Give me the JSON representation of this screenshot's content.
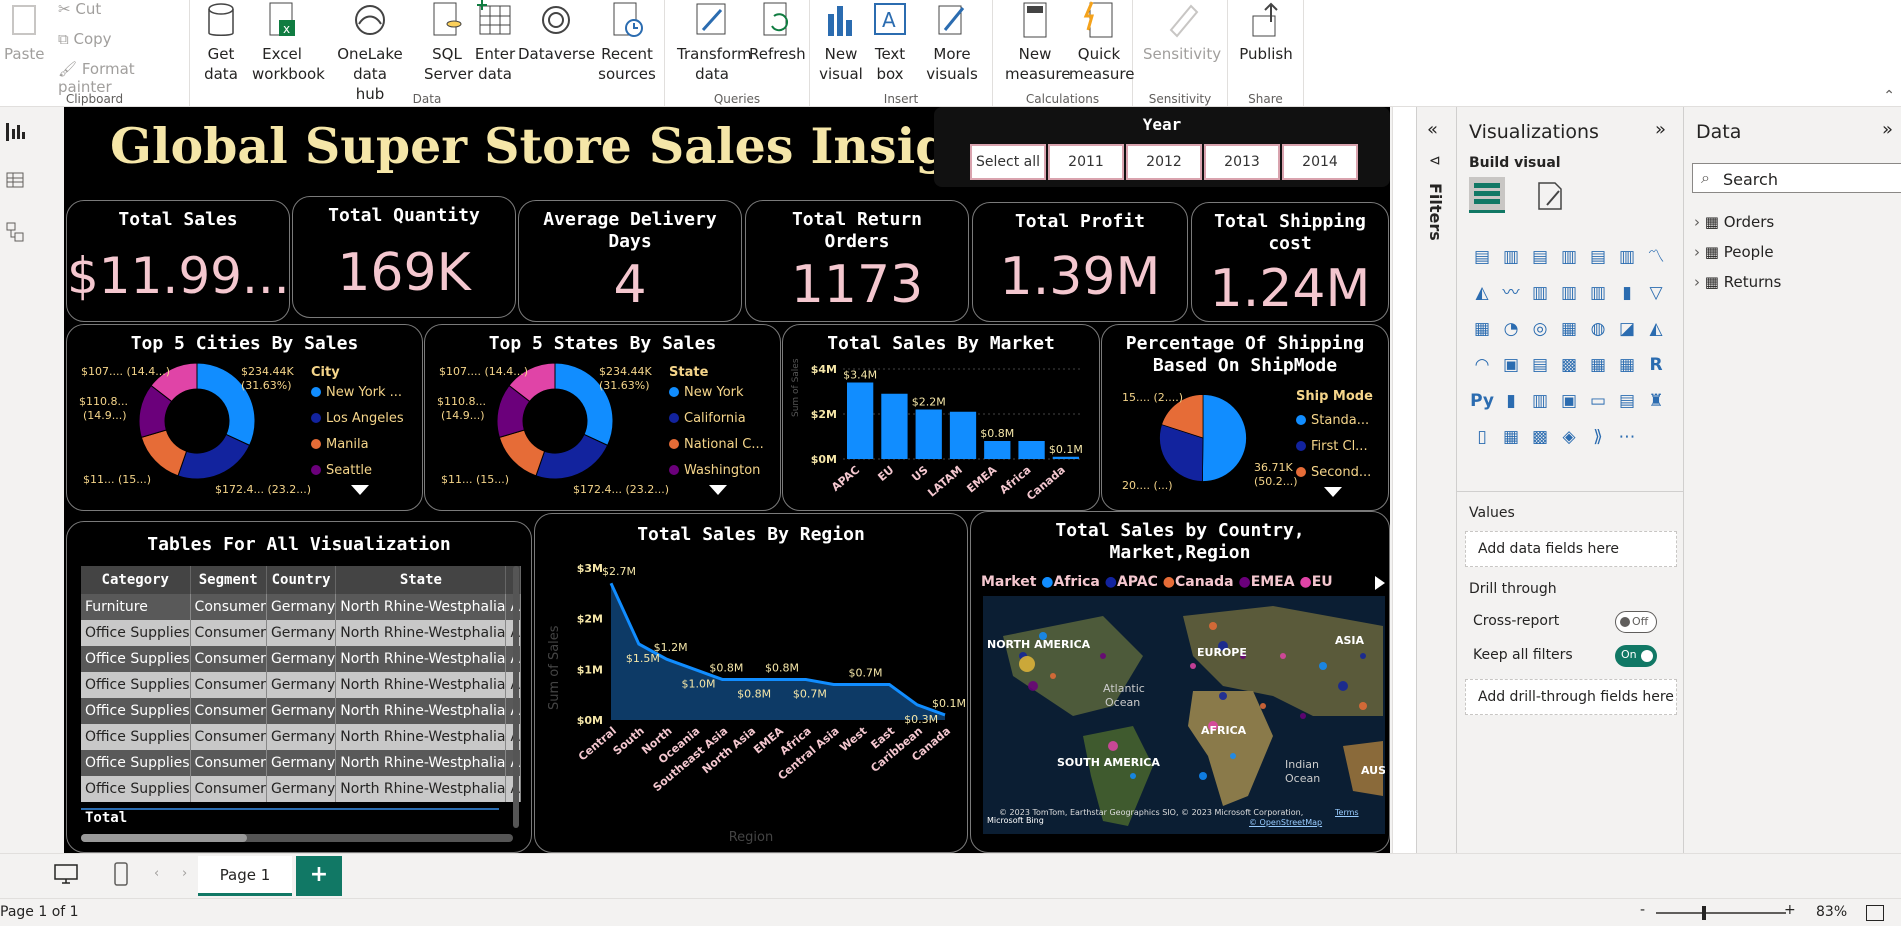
{
  "ribbon": {
    "clipboard": {
      "paste": "Paste",
      "cut": "Cut",
      "copy": "Copy",
      "format_painter": "Format painter",
      "group": "Clipboard"
    },
    "data": {
      "group": "Data",
      "get_data": [
        "Get",
        "data"
      ],
      "excel": [
        "Excel",
        "workbook"
      ],
      "onelake": [
        "OneLake data",
        "hub"
      ],
      "sql": [
        "SQL",
        "Server"
      ],
      "enter": [
        "Enter",
        "data"
      ],
      "dataverse": [
        "Dataverse",
        ""
      ],
      "recent": [
        "Recent",
        "sources"
      ]
    },
    "queries": {
      "group": "Queries",
      "transform": [
        "Transform",
        "data"
      ],
      "refresh": [
        "Refresh",
        ""
      ]
    },
    "insert": {
      "group": "Insert",
      "new_visual": [
        "New",
        "visual"
      ],
      "text_box": [
        "Text",
        "box"
      ],
      "more_visuals": [
        "More",
        "visuals"
      ]
    },
    "calculations": {
      "group": "Calculations",
      "new_measure": [
        "New",
        "measure"
      ],
      "quick_measure": [
        "Quick",
        "measure"
      ]
    },
    "sensitivity": {
      "group": "Sensitivity",
      "label": "Sensitivity"
    },
    "share": {
      "group": "Share",
      "publish": "Publish"
    }
  },
  "report": {
    "title": "Global Super Store Sales Insights",
    "year_slicer": {
      "title": "Year",
      "options": [
        "Select all",
        "2011",
        "2012",
        "2013",
        "2014"
      ]
    },
    "kpis": [
      {
        "title": "Total Sales",
        "value": "$11.99..."
      },
      {
        "title": "Total Quantity",
        "value": "169K"
      },
      {
        "title": "Average Delivery Days",
        "value": "4"
      },
      {
        "title": "Total Return Orders",
        "value": "1173"
      },
      {
        "title": "Total Profit",
        "value": "1.39M"
      },
      {
        "title": "Total Shipping cost",
        "value": "1.24M"
      }
    ],
    "cities": {
      "title": "Top 5 Cities By Sales",
      "legend_title": "City",
      "legend": [
        "New York ...",
        "Los Angeles",
        "Manila",
        "Seattle"
      ],
      "labels": {
        "top_left": "$107.... (14.4...)",
        "mid_left": "$110.8...",
        "mid_left2": "(14.9...)",
        "bottom_left": "$11... (15...)",
        "top_right": "$234.44K",
        "top_right2": "(31.63%)",
        "bottom_right": "$172.4... (23.2...)"
      }
    },
    "states": {
      "title": "Top 5 States By Sales",
      "legend_title": "State",
      "legend": [
        "New York",
        "California",
        "National C...",
        "Washington"
      ],
      "labels": {
        "top_left": "$107.... (14.4...)",
        "mid_left": "$110.8...",
        "mid_left2": "(14.9...)",
        "bottom_left": "$11... (15...)",
        "top_right": "$234.44K",
        "top_right2": "(31.63%)",
        "bottom_right": "$172.4... (23.2...)"
      }
    },
    "market": {
      "title": "Total Sales By Market",
      "ylabel": "Sum of Sales"
    },
    "shipmode": {
      "title": "Percentage Of Shipping Based On ShipMode",
      "legend_title": "Ship Mode",
      "legend": [
        "Standa...",
        "First Cl...",
        "Second..."
      ],
      "labels": {
        "top_left": "15.... (2....)",
        "bottom_left": "20.... (...)",
        "right": "36.71K",
        "right2": "(50.2...)"
      }
    },
    "table": {
      "title": "Tables For All Visualization",
      "columns": [
        "Category",
        "Segment",
        "Country",
        "State"
      ],
      "rows": [
        [
          "Furniture",
          "Consumer",
          "Germany",
          "North Rhine-Westphalia"
        ],
        [
          "Office Supplies",
          "Consumer",
          "Germany",
          "North Rhine-Westphalia"
        ],
        [
          "Office Supplies",
          "Consumer",
          "Germany",
          "North Rhine-Westphalia"
        ],
        [
          "Office Supplies",
          "Consumer",
          "Germany",
          "North Rhine-Westphalia"
        ],
        [
          "Office Supplies",
          "Consumer",
          "Germany",
          "North Rhine-Westphalia"
        ],
        [
          "Office Supplies",
          "Consumer",
          "Germany",
          "North Rhine-Westphalia"
        ],
        [
          "Office Supplies",
          "Consumer",
          "Germany",
          "North Rhine-Westphalia"
        ],
        [
          "Office Supplies",
          "Consumer",
          "Germany",
          "North Rhine-Westphalia"
        ]
      ],
      "extra_col": "A",
      "total": "Total"
    },
    "region": {
      "title": "Total Sales By Region",
      "ylabel": "Sum of Sales",
      "xlabel": "Region"
    },
    "map": {
      "title": "Total Sales by Country, Market,Region",
      "legend_title": "Market",
      "legend": [
        "Africa",
        "APAC",
        "Canada",
        "EMEA",
        "EU"
      ],
      "labels": [
        "NORTH AMERICA",
        "EUROPE",
        "ASIA",
        "Atlantic",
        "Ocean",
        "AFRICA",
        "SOUTH AMERICA",
        "Indian",
        "Ocean",
        "AUS"
      ],
      "attribution": "© 2023 TomTom, Earthstar Geographics SIO, © 2023 Microsoft Corporation,",
      "terms": "Terms",
      "osm": "© OpenStreetMap",
      "bing": "Microsoft Bing"
    }
  },
  "filters_label": "Filters",
  "viz_pane": {
    "title": "Visualizations",
    "build": "Build visual",
    "values": "Values",
    "add_fields": "Add data fields here",
    "drill": "Drill through",
    "cross_report": "Cross-report",
    "cross_state": "Off",
    "keep_filters": "Keep all filters",
    "keep_state": "On",
    "add_drill": "Add drill-through fields here"
  },
  "data_pane": {
    "title": "Data",
    "search_placeholder": "Search",
    "tables": [
      "Orders",
      "People",
      "Returns"
    ]
  },
  "pages": {
    "tab": "Page 1",
    "add": "+"
  },
  "status": {
    "page": "Page 1 of 1",
    "zoom": "83%",
    "minus": "-",
    "plus": "+"
  },
  "colors": {
    "gold": "#f5e6a8",
    "pink_value": "#f4c7cf",
    "blue": "#118dff",
    "navy": "#12239e",
    "orange": "#e66c37",
    "purple": "#6b007b",
    "magenta": "#e044a7"
  },
  "chart_data": [
    {
      "type": "bar",
      "title": "Total Sales By Market",
      "categories": [
        "APAC",
        "EU",
        "US",
        "LATAM",
        "EMEA",
        "Africa",
        "Canada"
      ],
      "values": [
        3.4,
        2.9,
        2.2,
        2.1,
        0.8,
        0.8,
        0.1
      ],
      "data_labels": [
        "$3.4M",
        "",
        "$2.2M",
        "",
        "$0.8M",
        "",
        "$0.1M"
      ],
      "yticks": [
        "$4M",
        "$2M",
        "$0M"
      ],
      "ylim": [
        0,
        4
      ],
      "unit": "$M"
    },
    {
      "type": "area",
      "title": "Total Sales By Region",
      "categories": [
        "Central",
        "South",
        "North",
        "Oceania",
        "Southeast Asia",
        "North Asia",
        "EMEA",
        "Africa",
        "Central Asia",
        "West",
        "East",
        "Caribbean",
        "Canada"
      ],
      "values": [
        2.7,
        1.5,
        1.2,
        1.0,
        0.8,
        0.8,
        0.8,
        0.8,
        0.7,
        0.7,
        0.7,
        0.3,
        0.1
      ],
      "data_labels": [
        "$2.7M",
        "$1.5M",
        "$1.2M",
        "$1.0M",
        "$0.8M",
        "$0.8M",
        "$0.8M",
        "$0.7M",
        "$0.7M",
        "$0.3M",
        "$0.1M"
      ],
      "yticks": [
        "$3M",
        "$2M",
        "$1M",
        "$0M"
      ],
      "ylim": [
        0,
        3
      ],
      "unit": "$M"
    },
    {
      "type": "pie",
      "title": "Top 5 Cities By Sales",
      "categories": [
        "New York City",
        "Los Angeles",
        "Manila",
        "Seattle",
        "Other"
      ],
      "values": [
        31.63,
        23.2,
        15,
        14.9,
        14.4
      ]
    },
    {
      "type": "pie",
      "title": "Top 5 States By Sales",
      "categories": [
        "New York",
        "California",
        "National Capital",
        "Washington",
        "Other"
      ],
      "values": [
        31.63,
        23.2,
        15,
        14.9,
        14.4
      ]
    },
    {
      "type": "pie",
      "title": "Percentage Of Shipping Based On ShipMode",
      "categories": [
        "Standard Class",
        "First Class",
        "Second Class"
      ],
      "values": [
        50.2,
        29.8,
        20
      ]
    }
  ]
}
